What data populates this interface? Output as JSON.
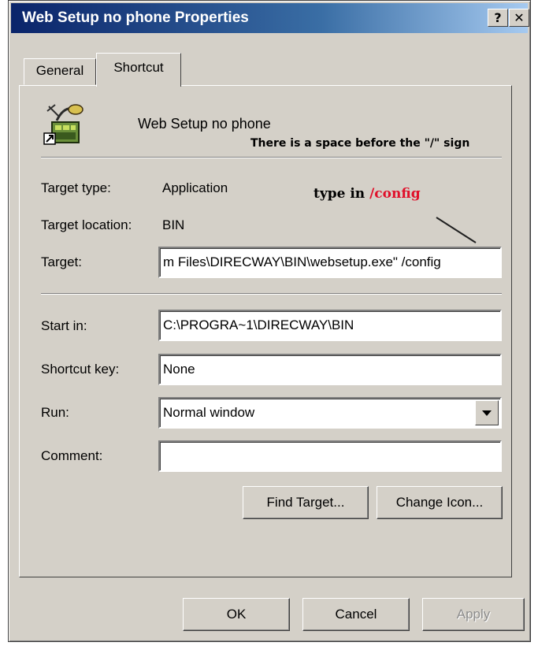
{
  "window": {
    "title": "Web Setup no phone Properties",
    "help_glyph": "?",
    "close_glyph": "✕"
  },
  "tabs": [
    {
      "label": "General"
    },
    {
      "label": "Shortcut"
    }
  ],
  "app_name": "Web Setup no phone",
  "notes": {
    "space_note": "There is a space before the \"/\" sign",
    "type_prefix": "type in ",
    "type_value": "/config",
    "type_value_color": "#e0102a"
  },
  "fields": {
    "target_type_label": "Target type:",
    "target_type_value": "Application",
    "target_location_label": "Target location:",
    "target_location_value": "BIN",
    "target_label": "Target:",
    "target_value": "m Files\\DIRECWAY\\BIN\\websetup.exe\" /config",
    "start_in_label": "Start in:",
    "start_in_value": "C:\\PROGRA~1\\DIRECWAY\\BIN",
    "shortcut_key_label": "Shortcut key:",
    "shortcut_key_value": "None",
    "run_label": "Run:",
    "run_value": "Normal window",
    "comment_label": "Comment:",
    "comment_value": ""
  },
  "buttons": {
    "find_target": "Find Target...",
    "change_icon": "Change Icon...",
    "ok": "OK",
    "cancel": "Cancel",
    "apply": "Apply"
  }
}
